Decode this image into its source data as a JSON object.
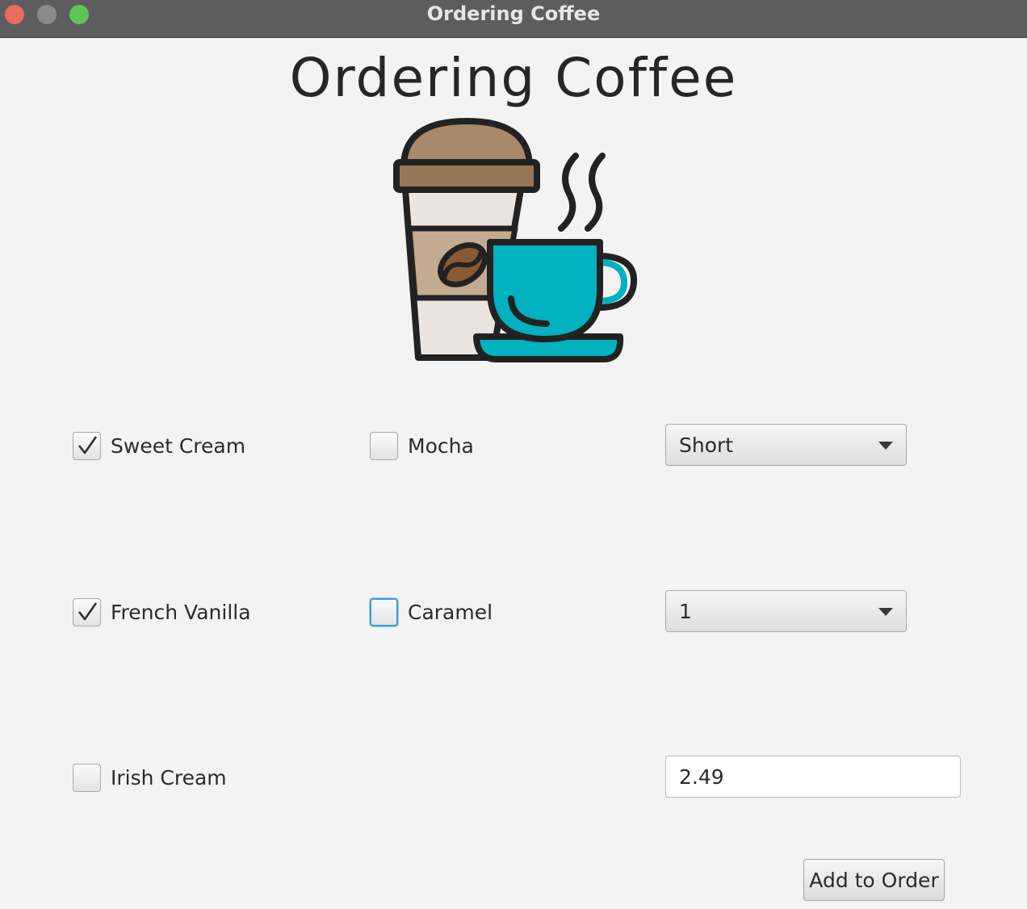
{
  "window": {
    "title": "Ordering Coffee"
  },
  "main": {
    "heading": "Ordering Coffee",
    "options": [
      {
        "label": "Sweet Cream",
        "checked": true
      },
      {
        "label": "Mocha",
        "checked": false
      },
      {
        "label": "French Vanilla",
        "checked": true
      },
      {
        "label": "Caramel",
        "checked": false,
        "focused": true
      },
      {
        "label": "Irish Cream",
        "checked": false
      }
    ],
    "size_select": {
      "value": "Short"
    },
    "quantity_select": {
      "value": "1"
    },
    "price_field": {
      "value": "2.49"
    },
    "add_button": {
      "label": "Add to Order"
    }
  },
  "icons": {
    "illustration": "coffee-cups-icon",
    "dropdown": "chevron-down-icon",
    "check": "checkmark-icon"
  },
  "colors": {
    "titlebar": "#5d5d5d",
    "close": "#ed6a5e",
    "minimize": "#8a8a8a",
    "maximize": "#61c554",
    "cup_teal": "#00b1bf",
    "focus_ring": "#3d9bd8"
  }
}
